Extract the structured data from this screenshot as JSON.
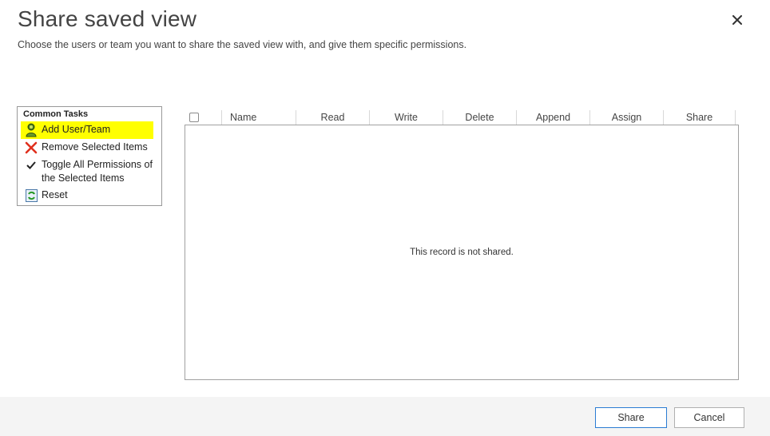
{
  "dialog": {
    "title": "Share saved view",
    "subtitle": "Choose the users or team you want to share the saved view with, and give them specific permissions."
  },
  "common_tasks": {
    "header": "Common Tasks",
    "items": [
      {
        "label": "Add User/Team",
        "icon": "add-user-icon",
        "highlighted": true
      },
      {
        "label": "Remove Selected Items",
        "icon": "red-x-icon"
      },
      {
        "label": "Toggle All Permissions of the Selected Items",
        "icon": "checkmark-icon"
      },
      {
        "label": "Reset",
        "icon": "reset-icon"
      }
    ]
  },
  "grid": {
    "columns": [
      "Name",
      "Read",
      "Write",
      "Delete",
      "Append",
      "Assign",
      "Share"
    ],
    "empty_message": "This record is not shared."
  },
  "footer": {
    "share_label": "Share",
    "cancel_label": "Cancel"
  },
  "colors": {
    "highlight": "#ffff00",
    "primary_border": "#2b7cd3",
    "footer_bg": "#f4f4f4"
  }
}
